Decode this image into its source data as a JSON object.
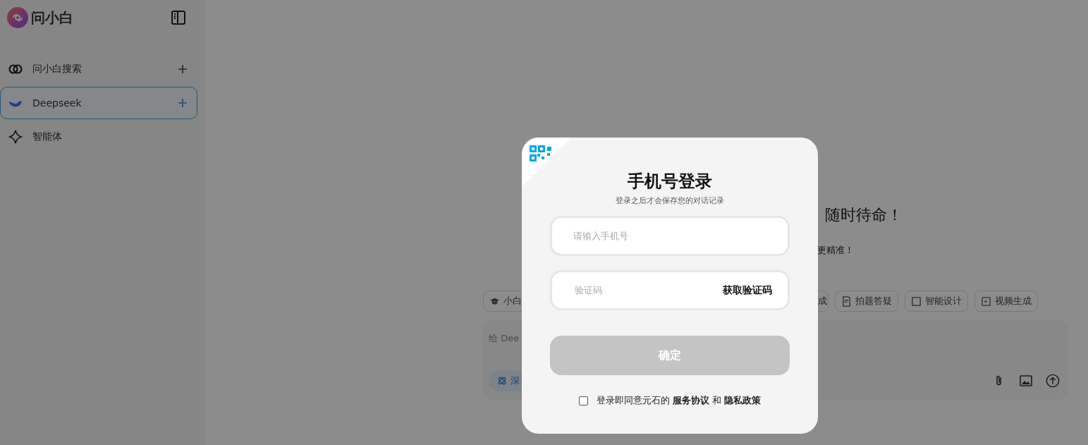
{
  "sidebar": {
    "logo": "问小白",
    "items": [
      {
        "label": "问小白搜索",
        "selected": false
      },
      {
        "label": "Deepseek",
        "selected": true
      },
      {
        "label": "智能体",
        "selected": false
      }
    ]
  },
  "main": {
    "heading": "随时待命！",
    "subtitle": "更精准！",
    "chips": [
      {
        "label": "小白"
      },
      {
        "label": "成"
      },
      {
        "label": "拍题答疑"
      },
      {
        "label": "智能设计"
      },
      {
        "label": "视频生成"
      }
    ],
    "composer": {
      "placeholder": "给 Dee",
      "toggle": {
        "label": "深",
        "on": true
      }
    }
  },
  "login": {
    "title": "手机号登录",
    "subtitle": "登录之后才会保存您的对话记录",
    "phone_placeholder": "请输入手机号",
    "code_placeholder": "验证码",
    "get_code": "获取验证码",
    "confirm": "确定",
    "agree_checked": false,
    "agreement": "登录即同意元石的 **服务协议** 和 **隐私政策**"
  }
}
